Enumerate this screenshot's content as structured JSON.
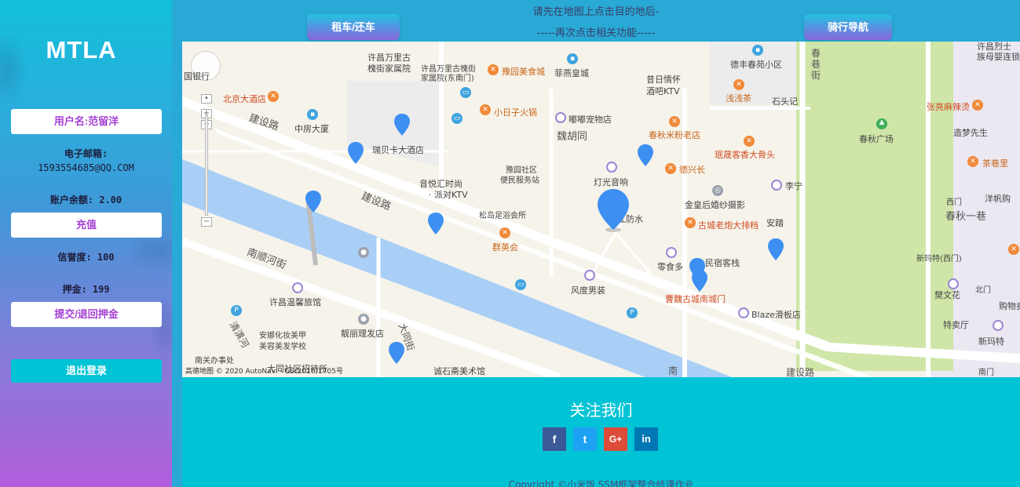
{
  "sidebar": {
    "brand": "MTLA",
    "username_button": "用户名:范留洋",
    "email_label": "电子邮箱:",
    "email_value": "1593554685@QQ.COM",
    "balance": "账户余额: 2.00",
    "recharge_button": "充值",
    "credit": "信誉度: 100",
    "deposit": "押金: 199",
    "deposit_button": "提交/退回押金",
    "logout_button": "退出登录"
  },
  "topbar": {
    "rent_button": "租车/还车",
    "hint_line1": "请先在地图上点击目的地后-",
    "hint_line2": "-----再次点击相关功能-----",
    "navigate_button": "骑行导航"
  },
  "map": {
    "labels": [
      {
        "text": "许昌万里古",
        "cls": ""
      },
      {
        "text": "槐街家属院",
        "cls": ""
      },
      {
        "text": "许昌万里古槐街",
        "cls": ""
      },
      {
        "text": "家属院(东南门)",
        "cls": ""
      },
      {
        "text": "豫园美食城",
        "cls": "o"
      },
      {
        "text": "菲燕皇城",
        "cls": ""
      },
      {
        "text": "昔日情怀",
        "cls": ""
      },
      {
        "text": "酒吧KTV",
        "cls": ""
      },
      {
        "text": "德丰春苑小区",
        "cls": ""
      },
      {
        "text": "浅浅茶",
        "cls": "o"
      },
      {
        "text": "石头记",
        "cls": ""
      },
      {
        "text": "许昌烈士",
        "cls": ""
      },
      {
        "text": "族母婴连锁",
        "cls": ""
      },
      {
        "text": "国银行",
        "cls": ""
      },
      {
        "text": "北京大酒店",
        "cls": "r"
      },
      {
        "text": "建设路",
        "cls": "b"
      },
      {
        "text": "中房大厦",
        "cls": ""
      },
      {
        "text": "瑞贝卡大酒店",
        "cls": ""
      },
      {
        "text": "小日子火锅",
        "cls": "o"
      },
      {
        "text": "嘟嘟宠物店",
        "cls": ""
      },
      {
        "text": "魏胡同",
        "cls": "b"
      },
      {
        "text": "春秋米粉老店",
        "cls": "o"
      },
      {
        "text": "张亮麻辣烫",
        "cls": "r"
      },
      {
        "text": "造梦先生",
        "cls": ""
      },
      {
        "text": "春秋广场",
        "cls": ""
      },
      {
        "text": "茶巷里",
        "cls": "o"
      },
      {
        "text": "豫园社区",
        "cls": ""
      },
      {
        "text": "便民服务站",
        "cls": ""
      },
      {
        "text": "珉晟客香大骨头",
        "cls": "r"
      },
      {
        "text": "德兴长",
        "cls": "o"
      },
      {
        "text": "音悦汇时尚",
        "cls": ""
      },
      {
        "text": "· 派对KTV",
        "cls": ""
      },
      {
        "text": "灯光音响",
        "cls": ""
      },
      {
        "text": "李宁",
        "cls": ""
      },
      {
        "text": "西门",
        "cls": ""
      },
      {
        "text": "洋帆购",
        "cls": ""
      },
      {
        "text": "建设路",
        "cls": "b"
      },
      {
        "text": "金皇后婚纱摄影",
        "cls": ""
      },
      {
        "text": "春秋一巷",
        "cls": "b"
      },
      {
        "text": "松岛足浴会所",
        "cls": ""
      },
      {
        "text": "江防水",
        "cls": ""
      },
      {
        "text": "古城老炮大排档",
        "cls": "r"
      },
      {
        "text": "安踏",
        "cls": ""
      },
      {
        "text": "群英会",
        "cls": "o"
      },
      {
        "text": "新玛特(西门)",
        "cls": ""
      },
      {
        "text": "南顺河街",
        "cls": "b"
      },
      {
        "text": "民宿客栈",
        "cls": ""
      },
      {
        "text": "零食多",
        "cls": ""
      },
      {
        "text": "北门",
        "cls": ""
      },
      {
        "text": "樊文花",
        "cls": ""
      },
      {
        "text": "许昌温馨旅馆",
        "cls": ""
      },
      {
        "text": "风度男装",
        "cls": ""
      },
      {
        "text": "曹魏古城南城门",
        "cls": "r"
      },
      {
        "text": "购物卖",
        "cls": ""
      },
      {
        "text": "Blaze滑板店",
        "cls": ""
      },
      {
        "text": "特卖厅",
        "cls": ""
      },
      {
        "text": "新玛特",
        "cls": ""
      },
      {
        "text": "清潩河",
        "cls": "b"
      },
      {
        "text": "安娜化妆美甲",
        "cls": ""
      },
      {
        "text": "美容美发学校",
        "cls": ""
      },
      {
        "text": "靓丽理发店",
        "cls": ""
      },
      {
        "text": "大同街",
        "cls": "b"
      },
      {
        "text": "南关办事处",
        "cls": ""
      },
      {
        "text": "大同社区招待所",
        "cls": ""
      },
      {
        "text": "诚石斋美术馆",
        "cls": ""
      },
      {
        "text": "南",
        "cls": "b"
      },
      {
        "text": "建设路",
        "cls": "b"
      },
      {
        "text": "南门",
        "cls": ""
      },
      {
        "text": "春巷街",
        "cls": "b"
      }
    ],
    "copyright": "高德地图 © 2020 AutoNavi - GS(2016)1705号"
  },
  "footer": {
    "title": "关注我们",
    "socials": [
      "f",
      "t",
      "G+",
      "in"
    ],
    "copyright": "Copyright ©小米饭 SSM框架整合结课作业"
  }
}
